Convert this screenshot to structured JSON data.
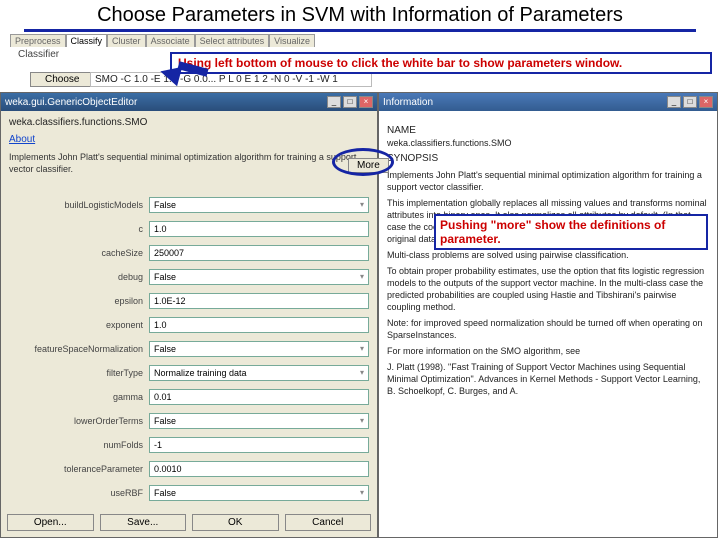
{
  "title": "Choose Parameters in SVM with Information of Parameters",
  "tabs": [
    "Preprocess",
    "Classify",
    "Cluster",
    "Associate",
    "Select attributes",
    "Visualize"
  ],
  "activeTabIdx": 1,
  "classifierLabel": "Classifier",
  "chooseLabel": "Choose",
  "cmdline": "SMO -C 1.0 -E 1.0 -G 0.0... P L 0 E 1 2 -N 0 -V -1 -W 1",
  "hint1": "Using left bottom of mouse to click the white bar to show parameters window.",
  "hint2": "Pushing  \"more\" show the definitions of  parameter.",
  "editor": {
    "title": "weka.gui.GenericObjectEditor",
    "className": "weka.classifiers.functions.SMO",
    "about": "About",
    "desc": "Implements John Platt's sequential minimal optimization algorithm for training a support vector classifier.",
    "more": "More",
    "params": [
      {
        "label": "buildLogisticModels",
        "value": "False",
        "dropdown": true
      },
      {
        "label": "c",
        "value": "1.0",
        "dropdown": false
      },
      {
        "label": "cacheSize",
        "value": "250007",
        "dropdown": false
      },
      {
        "label": "debug",
        "value": "False",
        "dropdown": true
      },
      {
        "label": "epsilon",
        "value": "1.0E-12",
        "dropdown": false
      },
      {
        "label": "exponent",
        "value": "1.0",
        "dropdown": false
      },
      {
        "label": "featureSpaceNormalization",
        "value": "False",
        "dropdown": true
      },
      {
        "label": "filterType",
        "value": "Normalize training data",
        "dropdown": true
      },
      {
        "label": "gamma",
        "value": "0.01",
        "dropdown": false
      },
      {
        "label": "lowerOrderTerms",
        "value": "False",
        "dropdown": true
      },
      {
        "label": "numFolds",
        "value": "-1",
        "dropdown": false
      },
      {
        "label": "toleranceParameter",
        "value": "0.0010",
        "dropdown": false
      },
      {
        "label": "useRBF",
        "value": "False",
        "dropdown": true
      }
    ],
    "buttons": [
      "Open...",
      "Save...",
      "OK",
      "Cancel"
    ]
  },
  "info": {
    "title": "Information",
    "nameLabel": "NAME",
    "name": "weka.classifiers.functions.SMO",
    "synLabel": "SYNOPSIS",
    "p1": "Implements John Platt's sequential minimal optimization algorithm for training a support vector classifier.",
    "p2": "This implementation globally replaces all missing values and transforms nominal attributes into binary ones. It also normalizes all attributes by default. (In that case the coefficients in the output are based on the normalized data, not the original data --- this is important for interpreting the classifier.)",
    "p3": "Multi-class problems are solved using pairwise classification.",
    "p4": "To obtain proper probability estimates, use the option that fits logistic regression models to the outputs of the support vector machine. In the multi-class case the predicted probabilities are coupled using Hastie and Tibshirani's pairwise coupling method.",
    "p5": "Note: for improved speed normalization should be turned off when operating on SparseInstances.",
    "p6": "For more information on the SMO algorithm, see",
    "p7": "J. Platt (1998). \"Fast Training of Support Vector Machines using Sequential Minimal Optimization\". Advances in Kernel Methods - Support Vector Learning, B. Schoelkopf, C. Burges, and A."
  }
}
